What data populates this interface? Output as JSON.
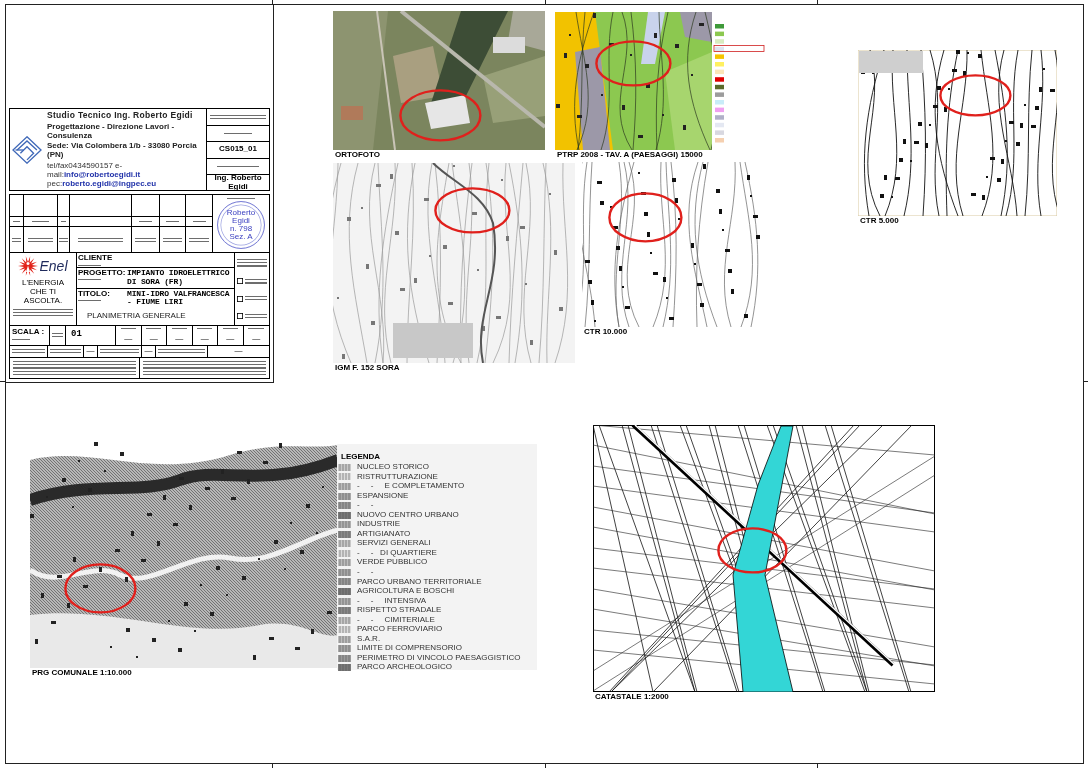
{
  "title_block": {
    "studio": {
      "name": "Studio Tecnico Ing. Roberto Egidi",
      "services": "Progettazione - Direzione Lavori - Consulenza",
      "address": "Sede: Via Colombera 1/b - 33080 Porcia (PN)",
      "contacts": "tel/fax0434590157 e-mail:**info@robertoegidi.it** pec:**roberto.egidi@ingpec.eu**"
    },
    "reference": {
      "code": "CS015_01",
      "responsible": "Ing. Roberto Egidi"
    },
    "stamp": {
      "lines": [
        "Roberto",
        "Egidi",
        "n. 798 Sez. A"
      ]
    },
    "client": {
      "logo_text": "Enel",
      "slogan": "L'ENERGIA CHE TI ASCOLTA."
    },
    "fields": [
      {
        "label": "CLIENTE"
      },
      {
        "label": "PROGETTO:",
        "value": "IMPIANTO IDROELETTRICO DI SORA (FR)"
      },
      {
        "label": "TITOLO:",
        "value": "MINI-IDRO VALFRANCESCA - FIUME LIRI",
        "subtitle": "PLANIMETRIA GENERALE"
      }
    ],
    "status_options": [
      {
        "checked": false
      },
      {
        "checked": false
      },
      {
        "checked": false
      }
    ],
    "scale": {
      "label": "SCALA :"
    },
    "sheet_number": "01",
    "code_values": [
      "—",
      "—",
      "—",
      "—",
      "—",
      "—"
    ],
    "info_values": [
      "—",
      "—",
      "—"
    ]
  },
  "maps": [
    {
      "kind": "aerial",
      "caption": "ORTOFOTO"
    },
    {
      "kind": "landscape",
      "caption": "PTRP 2008 - TAV. A (PAESAGGI) 15000"
    },
    {
      "kind": "ctr",
      "caption": "CTR 5.000"
    },
    {
      "kind": "igm",
      "caption": "IGM F. 152 SORA"
    },
    {
      "kind": "ctr",
      "caption": "CTR 10.000"
    },
    {
      "kind": "zoning",
      "caption": "PRG COMUNALE 1:10.000"
    },
    {
      "kind": "cadastral",
      "caption": "CATASTALE 1:2000"
    }
  ],
  "legend": {
    "title": "LEGENDA",
    "entries": [
      "NUCLEO STORICO",
      "RISTRUTTURAZIONE",
      "-     -     E COMPLETAMENTO",
      "ESPANSIONE",
      "-     -",
      "NUOVO CENTRO URBANO",
      "INDUSTRIE",
      "ARTIGIANATO",
      "SERVIZI GENERALI",
      "-     -   DI QUARTIERE",
      "VERDE PUBBLICO",
      "-     -",
      "PARCO URBANO TERRITORIALE",
      "AGRICOLTURA E BOSCHI",
      "-     -     INTENSIVA",
      "RISPETTO STRADALE",
      "-     -     CIMITERIALE",
      "PARCO FERROVIARIO",
      "S.A.R.",
      "LIMITE DI COMPRENSORIO",
      "PERIMETRO DI VINCOLO PAESAGGISTICO",
      "PARCO ARCHEOLOGICO"
    ]
  }
}
